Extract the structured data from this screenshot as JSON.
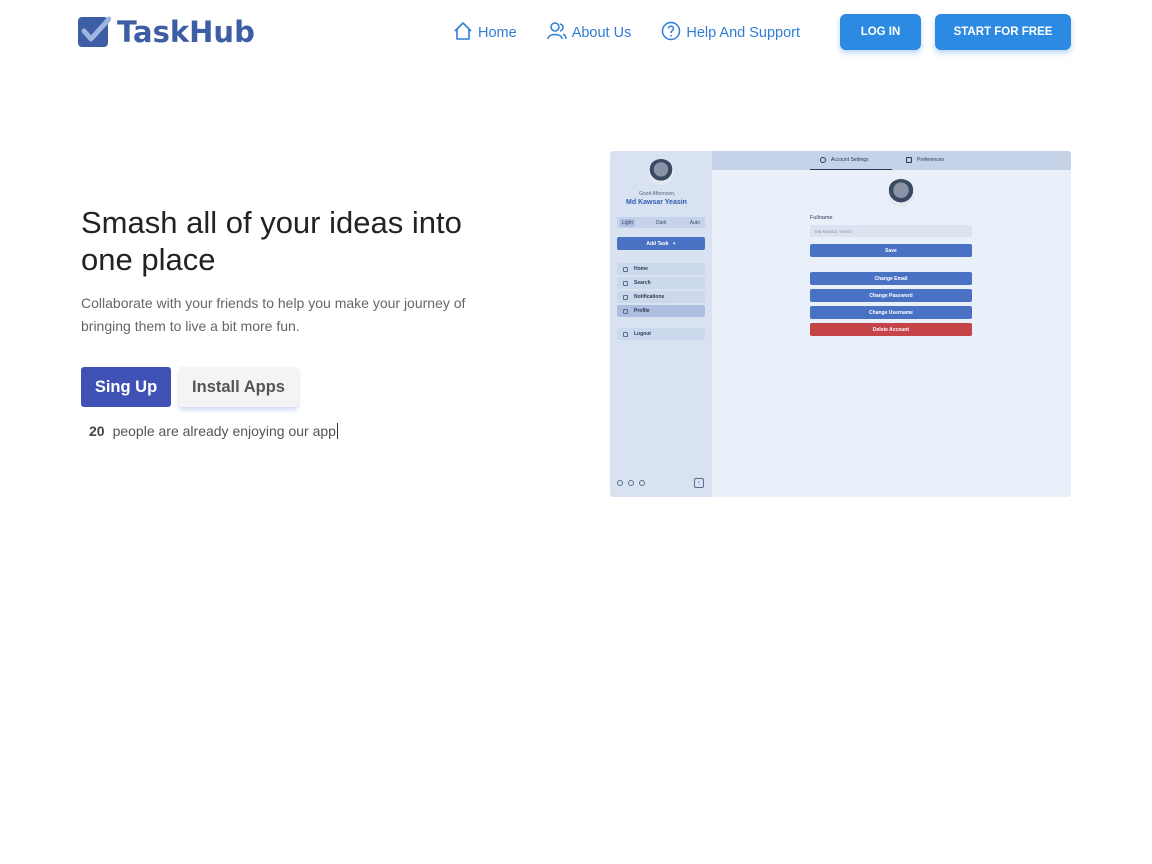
{
  "brand": {
    "name": "TaskHub",
    "accent": "#3d5da5"
  },
  "nav": {
    "items": [
      {
        "label": "Home",
        "icon": "home-icon"
      },
      {
        "label": "About Us",
        "icon": "users-icon"
      },
      {
        "label": "Help And Support",
        "icon": "help-circle-icon"
      }
    ],
    "login_label": "LOG IN",
    "start_label": "START FOR FREE",
    "button_color": "#2d8ae2"
  },
  "hero": {
    "title": "Smash all of your ideas into one place",
    "subtitle": "Collaborate with your friends to help you make your journey of bringing them to live a bit more fun.",
    "signup_label": "Sing Up",
    "install_label": "Install Apps",
    "users_count": "20",
    "users_text": "people are already enjoying our app",
    "primary_color": "#3f51b5"
  },
  "preview": {
    "greeting": "Good Afternoon,",
    "username": "Md Kawsar Yeasin",
    "theme_options": [
      "Light",
      "Dark",
      "Auto"
    ],
    "theme_selected": "Light",
    "add_task_label": "Add Task",
    "add_task_symbol": "+",
    "menu": [
      "Home",
      "Search",
      "Notifications",
      "Profile"
    ],
    "menu_active": "Profile",
    "logout_label": "Logout",
    "tabs": [
      "Account Settings",
      "Preferences"
    ],
    "fullname_label": "Fullname",
    "fullname_placeholder": "Md Kawsar Yeasin",
    "save_label": "Save",
    "change_email_label": "Change Email",
    "change_password_label": "Change Password",
    "change_username_label": "Change Username",
    "delete_account_label": "Delete Account",
    "collapse_symbol": "‹",
    "danger_color": "#c44447"
  }
}
